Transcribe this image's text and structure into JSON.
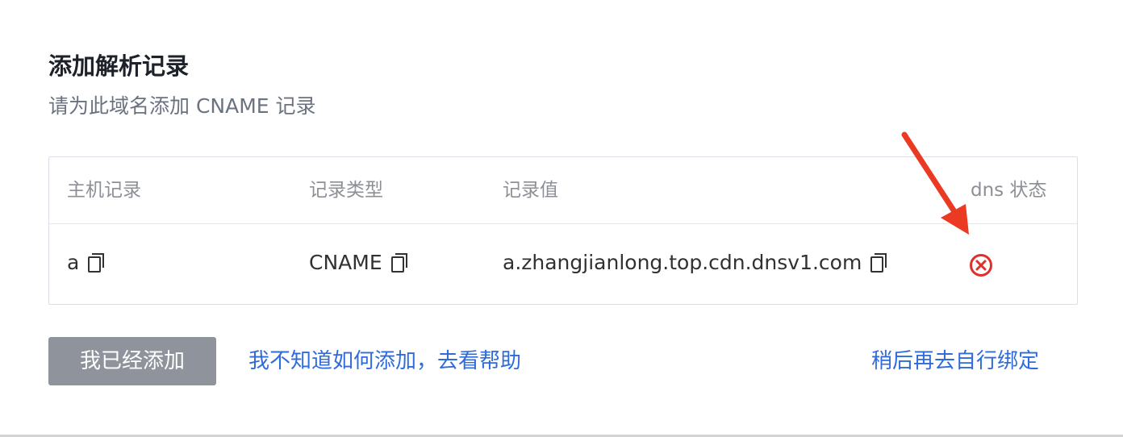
{
  "dialog": {
    "title": "添加解析记录",
    "subtitle": "请为此域名添加 CNAME 记录"
  },
  "table": {
    "headers": [
      "主机记录",
      "记录类型",
      "记录值",
      "dns 状态"
    ],
    "rows": [
      {
        "host": "a",
        "type": "CNAME",
        "value": "a.zhangjianlong.top.cdn.dnsv1.com",
        "dns_status": "error"
      }
    ]
  },
  "actions": {
    "confirm_button": "我已经添加",
    "help_link": "我不知道如何添加，去看帮助",
    "later_link": "稍后再去自行绑定"
  },
  "colors": {
    "link": "#2f6bd9",
    "button_bg": "#8f939c",
    "status_error": "#e0302b",
    "annotation_arrow": "#ea3a24"
  },
  "icons": {
    "copy": "copy-icon",
    "status": "error-circle-x-icon",
    "annotation": "red-arrow"
  }
}
